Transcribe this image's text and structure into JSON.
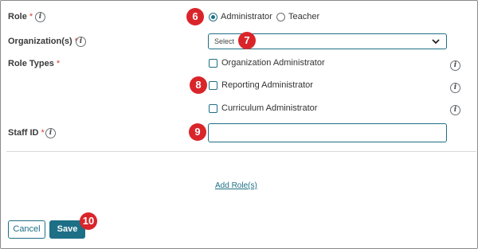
{
  "form": {
    "role": {
      "label": "Role",
      "required_mark": "*",
      "options": [
        {
          "label": "Administrator",
          "selected": true
        },
        {
          "label": "Teacher",
          "selected": false
        }
      ]
    },
    "organizations": {
      "label": "Organization(s)",
      "required_mark": "*",
      "select_value": "Select"
    },
    "role_types": {
      "label": "Role Types",
      "required_mark": "*",
      "options": [
        {
          "label": "Organization Administrator",
          "checked": false
        },
        {
          "label": "Reporting Administrator",
          "checked": false
        },
        {
          "label": "Curriculum Administrator",
          "checked": false
        }
      ]
    },
    "staff_id": {
      "label": "Staff ID",
      "required_mark": "*",
      "value": ""
    },
    "info_glyph": "i",
    "add_role_link": "Add Role(s)",
    "cancel_label": "Cancel",
    "save_label": "Save"
  },
  "callouts": [
    "6",
    "7",
    "8",
    "9",
    "10"
  ],
  "colors": {
    "accent": "#1d6f86",
    "required": "#d0423a",
    "callout": "#d9252a"
  }
}
